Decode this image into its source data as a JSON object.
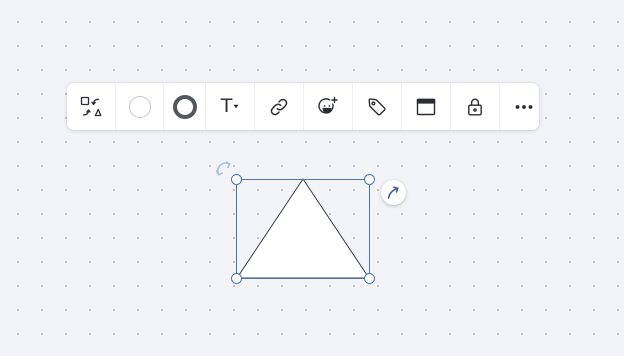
{
  "toolbar": {
    "items": [
      {
        "icon": "shape-switcher-icon",
        "label": ""
      },
      {
        "icon": "fill-color-icon",
        "label": ""
      },
      {
        "icon": "border-color-icon",
        "label": ""
      },
      {
        "icon": "text-format-icon",
        "label": "T"
      },
      {
        "icon": "link-icon",
        "label": ""
      },
      {
        "icon": "add-reaction-icon",
        "label": ""
      },
      {
        "icon": "tag-icon",
        "label": ""
      },
      {
        "icon": "frame-icon",
        "label": ""
      },
      {
        "icon": "lock-icon",
        "label": ""
      },
      {
        "icon": "more-options-icon",
        "label": ""
      }
    ]
  },
  "colors": {
    "canvas": "#f2f3f6",
    "grid_dot": "#b9bcc7",
    "selection": "#4a76a8",
    "shape_fill": "#ffffff",
    "shape_stroke": "#3a3c42",
    "fill_swatch": "#ffffff",
    "stroke_swatch": "#555760",
    "connector_arrow": "#3d55b0",
    "rotate_hint": "#a9bfdc"
  },
  "canvas": {
    "selected_shape": "triangle",
    "selection_handles": [
      "top-left",
      "top-right",
      "bottom-left",
      "bottom-right"
    ],
    "rotate_icon": "rotate-icon",
    "connector_icon": "connector-arrow-icon"
  }
}
